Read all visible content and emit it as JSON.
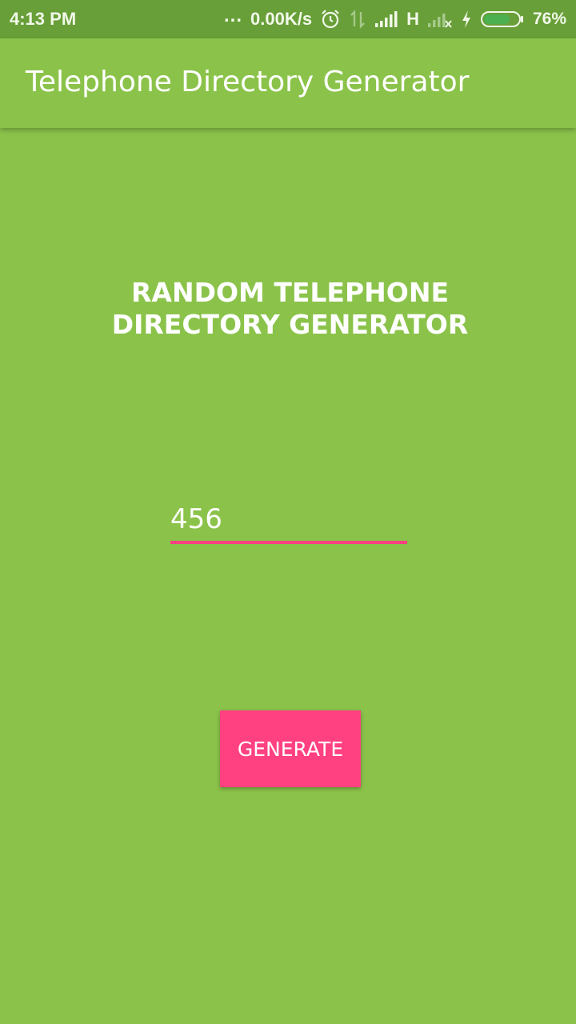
{
  "status_bar": {
    "time": "4:13 PM",
    "dots": "...",
    "network_speed": "0.00K/s",
    "network_type": "H",
    "battery_percent": "76%",
    "icons": [
      "alarm-icon",
      "data-arrows-icon",
      "signal-icon",
      "no-signal-icon",
      "charging-icon",
      "battery-icon"
    ],
    "battery_level": 0.76,
    "battery_color": "#4caf50"
  },
  "app_bar": {
    "title": "Telephone Directory Generator"
  },
  "main": {
    "heading": "RANDOM TELEPHONE DIRECTORY GENERATOR",
    "count_input": {
      "value": "456",
      "placeholder": ""
    },
    "generate_label": "GENERATE"
  },
  "colors": {
    "background": "#8bc34a",
    "status_bar": "#689f38",
    "accent": "#ff4081",
    "text": "#ffffff"
  }
}
